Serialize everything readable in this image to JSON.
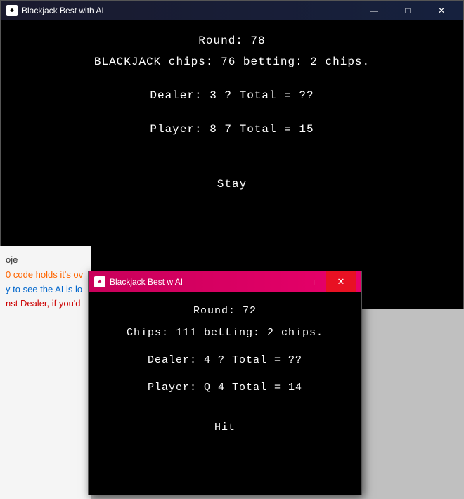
{
  "bg_window": {
    "title": "Blackjack Best with AI",
    "titlebar_icon": "♠",
    "controls": {
      "minimize": "—",
      "maximize": "□",
      "close": "✕"
    },
    "content": {
      "round_label": "Round :",
      "round_value": "78",
      "round_display": "Round: 78",
      "info_display": "BLACKJACK    chips: 76    betting: 2 chips.",
      "dealer_display": "Dealer: 3 ?   Total = ??",
      "player_display": "Player: 8 7 Total = 15",
      "action_display": "Stay"
    }
  },
  "fg_window": {
    "title": "Blackjack Best w AI",
    "titlebar_icon": "♠",
    "controls": {
      "minimize": "—",
      "maximize": "□",
      "close": "✕"
    },
    "content": {
      "round_display": "Round: 72",
      "info_display": "Chips: 111    betting: 2 chips.",
      "dealer_display": "Dealer: 4 ?   Total = ??",
      "player_display": "Player: Q 4 Total = 14",
      "action_display": "Hit"
    }
  },
  "side_content": {
    "line1": "oje",
    "line2": "0 code holds it's ov",
    "line3": "y to see the AI is lo",
    "line4": "nst Dealer, if you'd"
  }
}
